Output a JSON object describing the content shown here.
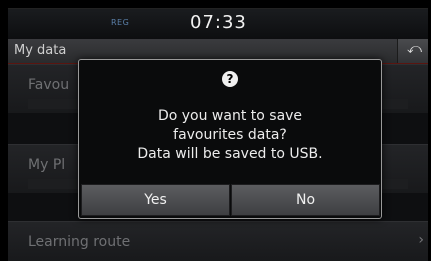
{
  "status": {
    "reg": "REG",
    "time": "07:33"
  },
  "header": {
    "title": "My data",
    "back_icon": "back-arrow-icon"
  },
  "list": {
    "items": [
      {
        "label": "Favou"
      },
      {
        "label": "My Pl"
      },
      {
        "label": "Learning route"
      }
    ],
    "chevron": "›"
  },
  "dialog": {
    "icon": "?",
    "lines": [
      "Do you want to save",
      "favourites data?",
      "Data will be saved to USB."
    ],
    "yes_label": "Yes",
    "no_label": "No"
  }
}
